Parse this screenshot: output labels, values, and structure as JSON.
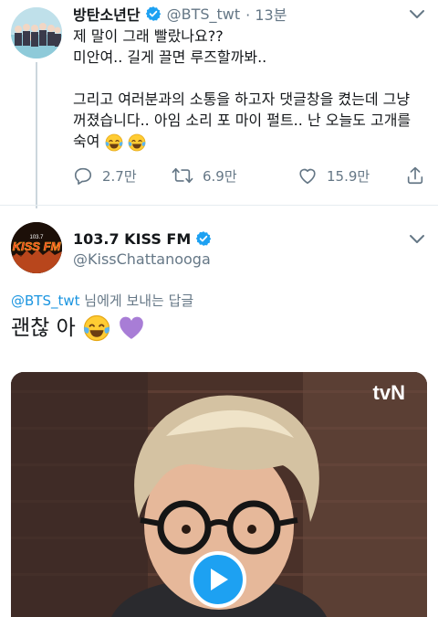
{
  "tweet1": {
    "author_name": "방탄소년단",
    "handle": "@BTS_twt",
    "time": "· 13분",
    "lines": [
      "제 말이 그래 빨랐나요??",
      "미안여.. 길게 끌면 루즈할까봐..",
      "그리고 여러분과의 소통을 하고자 댓글창을 켰는데 그냥",
      "꺼졌습니다.. 아임 소리 포 마이 펄트.. 난 오늘도 고개를",
      "숙여"
    ],
    "actions": {
      "replies": "2.7만",
      "retweets": "6.9만",
      "likes": "15.9만"
    }
  },
  "tweet2": {
    "author_name": "103.7 KISS FM",
    "handle": "@KissChattanooga",
    "replying_mention": "@BTS_twt",
    "replying_suffix": " 님에게 보내는 답글",
    "text": "괜찮 아",
    "media": {
      "watermark": "tvN",
      "type": "video"
    }
  },
  "avatar2_logo": "KISS FM",
  "icons": [
    "verified-badge-icon",
    "chevron-down-icon",
    "reply-icon",
    "retweet-icon",
    "like-icon",
    "share-icon",
    "play-icon",
    "tears-of-joy-emoji",
    "purple-heart-emoji"
  ],
  "colors": {
    "accent": "#1da1f2",
    "secondary_text": "#657786",
    "mention": "#1b95e0",
    "purple_heart": "#a87dd6"
  }
}
